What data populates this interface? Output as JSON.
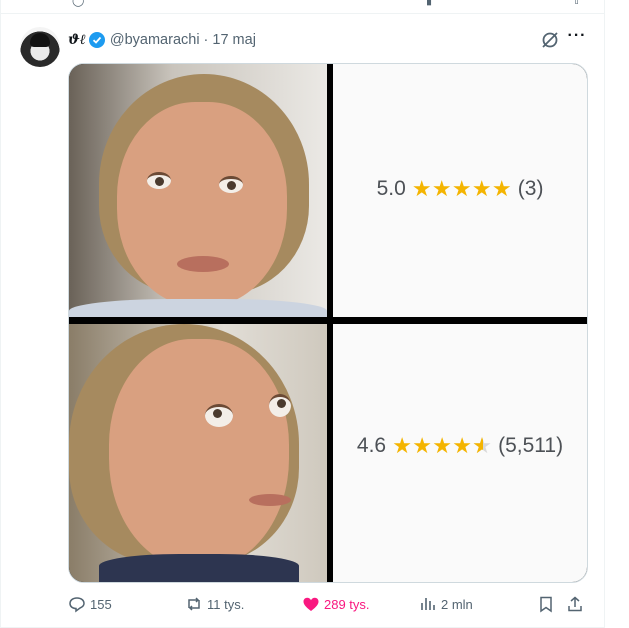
{
  "tweet": {
    "display_name": "ϑℓ",
    "handle": "@byamarachi",
    "separator": "·",
    "time": "17 maj"
  },
  "media": {
    "top_rating": {
      "value": "5.0",
      "stars": 5,
      "count": "(3)"
    },
    "bottom_rating": {
      "value": "4.6",
      "stars": 4.5,
      "count": "(5,511)"
    }
  },
  "actions": {
    "replies": "155",
    "reposts": "11 tys.",
    "likes": "289 tys.",
    "views": "2 mln"
  },
  "colors": {
    "accent": "#1d9bf0",
    "like": "#f91880",
    "muted": "#536471",
    "star": "#f4b400"
  },
  "icons": [
    "verified-badge-icon",
    "grok-icon",
    "more-icon",
    "reply-icon",
    "repost-icon",
    "like-icon",
    "views-icon",
    "bookmark-icon",
    "share-icon"
  ]
}
